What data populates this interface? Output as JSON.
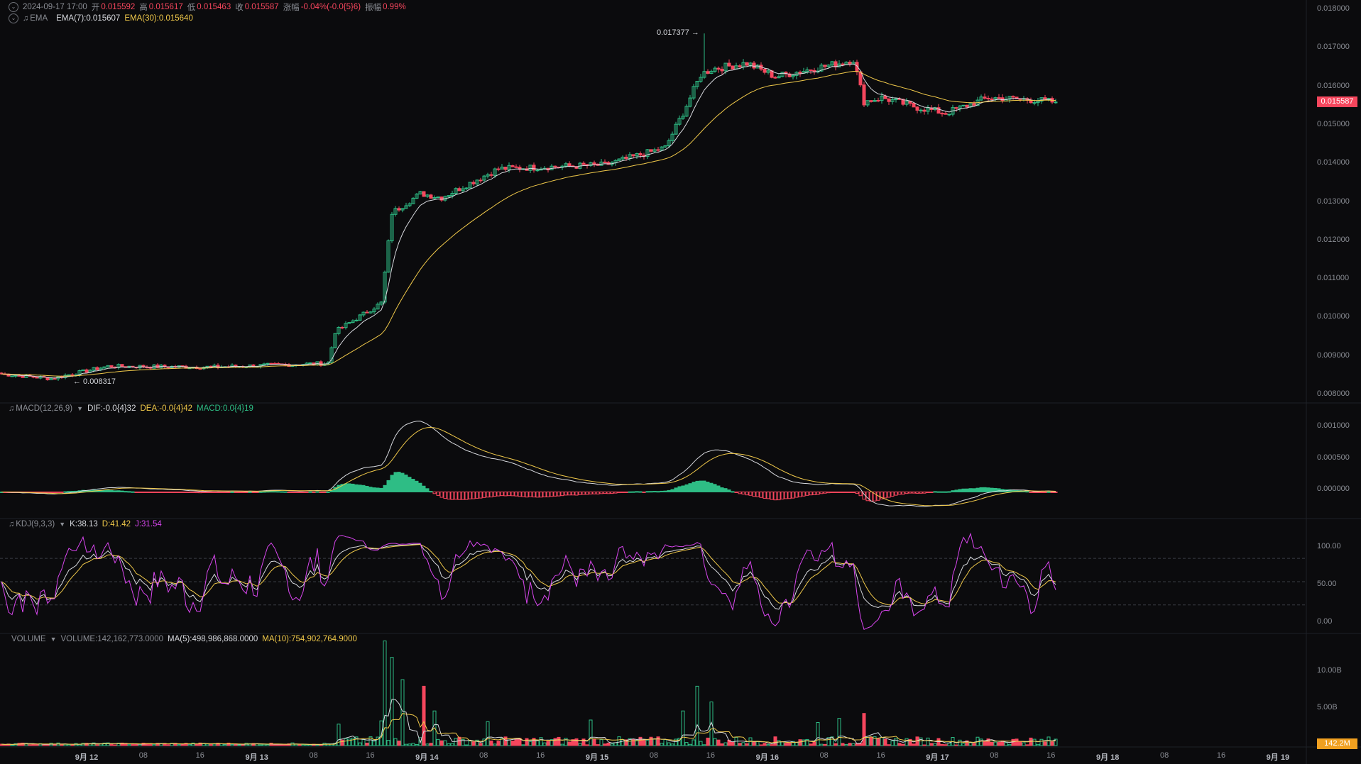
{
  "header": {
    "datetime": "2024-09-17 17:00",
    "open_label": "开",
    "open": "0.015592",
    "high_label": "高",
    "high": "0.015617",
    "low_label": "低",
    "low": "0.015463",
    "close_label": "收",
    "close": "0.015587",
    "change_label": "涨幅",
    "change": "-0.04%(-0.0{5}6)",
    "amplitude_label": "振幅",
    "amplitude": "0.99%"
  },
  "ema_legend": {
    "name": "EMA",
    "ema7": "EMA(7):0.015607",
    "ema30": "EMA(30):0.015640"
  },
  "macd_legend": {
    "name": "MACD(12,26,9)",
    "dif": "DIF:-0.0{4}32",
    "dea": "DEA:-0.0{4}42",
    "macd": "MACD:0.0{4}19"
  },
  "kdj_legend": {
    "name": "KDJ(9,3,3)",
    "k": "K:38.13",
    "d": "D:41.42",
    "j": "J:31.54"
  },
  "volume_legend": {
    "name": "VOLUME",
    "volume": "VOLUME:142,162,773.0000",
    "ma5": "MA(5):498,986,868.0000",
    "ma10": "MA(10):754,902,764.9000"
  },
  "price_axis": [
    "0.018000",
    "0.017000",
    "0.016000",
    "0.015000",
    "0.014000",
    "0.013000",
    "0.012000",
    "0.011000",
    "0.010000",
    "0.009000",
    "0.008000"
  ],
  "macd_axis": [
    "0.001000",
    "0.000500",
    "0.000000"
  ],
  "kdj_axis": [
    "100.00",
    "50.00",
    "0.00"
  ],
  "volume_axis": [
    "10.00B",
    "5.00B"
  ],
  "current_price_tag": "0.015587",
  "current_volume_tag": "142.2M",
  "high_marker": "0.017377 →",
  "low_marker": "← 0.008317",
  "time_axis": [
    {
      "label": "9月 12",
      "day": true
    },
    {
      "label": "08",
      "day": false
    },
    {
      "label": "16",
      "day": false
    },
    {
      "label": "9月 13",
      "day": true
    },
    {
      "label": "08",
      "day": false
    },
    {
      "label": "16",
      "day": false
    },
    {
      "label": "9月 14",
      "day": true
    },
    {
      "label": "08",
      "day": false
    },
    {
      "label": "16",
      "day": false
    },
    {
      "label": "9月 15",
      "day": true
    },
    {
      "label": "08",
      "day": false
    },
    {
      "label": "16",
      "day": false
    },
    {
      "label": "9月 16",
      "day": true
    },
    {
      "label": "08",
      "day": false
    },
    {
      "label": "16",
      "day": false
    },
    {
      "label": "9月 17",
      "day": true
    },
    {
      "label": "08",
      "day": false
    },
    {
      "label": "16",
      "day": false
    },
    {
      "label": "9月 18",
      "day": true
    },
    {
      "label": "08",
      "day": false
    },
    {
      "label": "16",
      "day": false
    },
    {
      "label": "9月 19",
      "day": true
    }
  ],
  "colors": {
    "up": "#2ebd85",
    "down": "#f6465d",
    "ema7": "#d7d9de",
    "ema30": "#f0c94a",
    "j": "#d946ef",
    "bg": "#0b0b0d",
    "volTag": "#f0a020"
  },
  "chart_data": {
    "type": "candlestick",
    "interval": "1h",
    "price_range": [
      0.0078,
      0.0181
    ],
    "macd_range": [
      -0.00035,
      0.0012
    ],
    "kdj_range": [
      -15,
      125
    ],
    "kdj_guides": [
      80,
      50,
      20
    ],
    "volume_range": [
      0,
      13000000000
    ],
    "key_points": [
      {
        "t": 0,
        "price": 0.0085
      },
      {
        "t": 14,
        "price": 0.00838
      },
      {
        "t": 30,
        "price": 0.0087
      },
      {
        "t": 60,
        "price": 0.00868
      },
      {
        "t": 92,
        "price": 0.00878
      },
      {
        "t": 94,
        "price": 0.0096
      },
      {
        "t": 107,
        "price": 0.01035
      },
      {
        "t": 110,
        "price": 0.0127
      },
      {
        "t": 118,
        "price": 0.0132
      },
      {
        "t": 124,
        "price": 0.0131
      },
      {
        "t": 140,
        "price": 0.01385
      },
      {
        "t": 170,
        "price": 0.01395
      },
      {
        "t": 187,
        "price": 0.0144
      },
      {
        "t": 192,
        "price": 0.0153
      },
      {
        "t": 197,
        "price": 0.0163
      },
      {
        "t": 200,
        "price": 0.01645
      },
      {
        "t": 210,
        "price": 0.0166
      },
      {
        "t": 218,
        "price": 0.01625
      },
      {
        "t": 236,
        "price": 0.0166
      },
      {
        "t": 240,
        "price": 0.0167
      },
      {
        "t": 243,
        "price": 0.0156
      },
      {
        "t": 248,
        "price": 0.0157
      },
      {
        "t": 258,
        "price": 0.01545
      },
      {
        "t": 266,
        "price": 0.0153
      },
      {
        "t": 278,
        "price": 0.0157
      },
      {
        "t": 290,
        "price": 0.01565
      },
      {
        "t": 297,
        "price": 0.015587
      }
    ],
    "high": 0.017377,
    "low": 0.008317,
    "volume_spikes": [
      {
        "t": 95,
        "value": 2600000000
      },
      {
        "t": 107,
        "value": 3000000000
      },
      {
        "t": 108,
        "value": 12700000000
      },
      {
        "t": 110,
        "value": 10700000000
      },
      {
        "t": 113,
        "value": 8000000000
      },
      {
        "t": 119,
        "value": 7200000000
      },
      {
        "t": 122,
        "value": 4200000000
      },
      {
        "t": 137,
        "value": 2900000000
      },
      {
        "t": 166,
        "value": 3100000000
      },
      {
        "t": 192,
        "value": 4200000000
      },
      {
        "t": 196,
        "value": 7200000000
      },
      {
        "t": 200,
        "value": 5300000000
      },
      {
        "t": 230,
        "value": 2800000000
      },
      {
        "t": 236,
        "value": 3300000000
      },
      {
        "t": 243,
        "value": 3900000000
      },
      {
        "t": 292,
        "value": 142162773
      }
    ]
  }
}
